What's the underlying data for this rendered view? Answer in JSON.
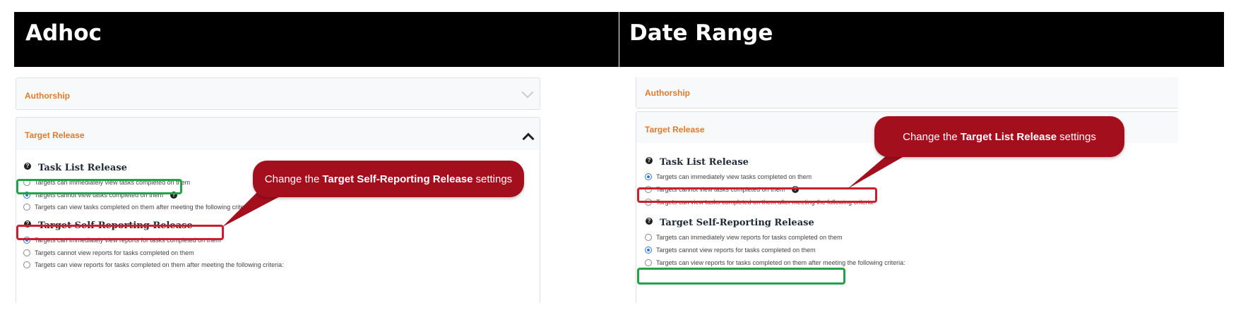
{
  "headers": {
    "left": "Adhoc",
    "right": "Date Range"
  },
  "authorship_title": "Authorship",
  "target_release_title": "Target Release",
  "task_list": {
    "title": "Task List Release",
    "options": [
      "Targets can immediately view tasks completed on them",
      "Targets cannot view tasks completed on them",
      "Targets can view tasks completed on them after meeting the following criteria:"
    ]
  },
  "self_reporting": {
    "title": "Target Self-Reporting Release",
    "options": [
      "Targets can immediately view reports for tasks completed on them",
      "Targets cannot view reports for tasks completed on them",
      "Targets can view reports for tasks completed on them after meeting the following criteria:"
    ]
  },
  "adhoc": {
    "task_list_selected": 1,
    "self_reporting_selected": 0,
    "callout": {
      "prefix": "Change the",
      "bold": "Target Self-Reporting Release",
      "suffix": "settings"
    }
  },
  "date_range": {
    "task_list_selected": 0,
    "self_reporting_selected": 1,
    "callout": {
      "prefix": "Change the",
      "bold": "Target List Release",
      "suffix": "settings"
    }
  },
  "colors": {
    "accent_orange": "#e07a2c",
    "callout_red": "#a30f1d",
    "highlight_red": "#c8202f",
    "highlight_green": "#22a347",
    "radio_blue": "#2f75d6"
  },
  "icons": {
    "help": "question-circle-icon",
    "collapse": "chevron-up-icon",
    "expand": "chevron-down-icon"
  }
}
